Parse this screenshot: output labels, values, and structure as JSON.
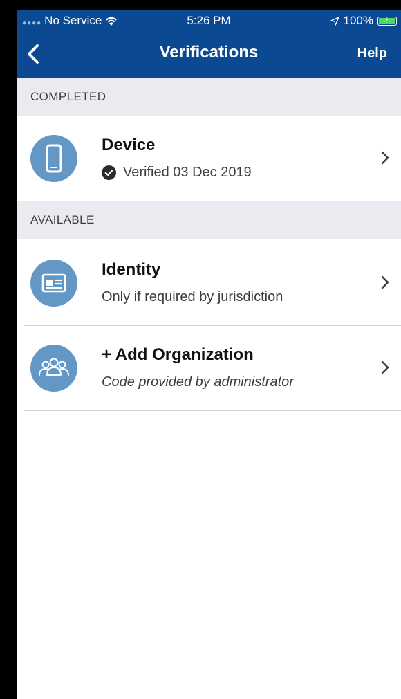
{
  "status_bar": {
    "carrier": "No Service",
    "time": "5:26 PM",
    "battery": "100%"
  },
  "nav": {
    "title": "Verifications",
    "help_label": "Help"
  },
  "sections": {
    "completed_label": "COMPLETED",
    "available_label": "AVAILABLE"
  },
  "rows": {
    "device": {
      "title": "Device",
      "subtitle": "Verified 03 Dec 2019",
      "icon": "phone-icon"
    },
    "identity": {
      "title": "Identity",
      "subtitle": "Only if required by jurisdiction",
      "icon": "id-card-icon"
    },
    "organization": {
      "title": "+ Add Organization",
      "subtitle": "Code provided by administrator",
      "icon": "group-icon"
    }
  },
  "colors": {
    "header_blue": "#0b4a93",
    "icon_circle": "#6398c6",
    "section_bg": "#eceaf1",
    "battery_green": "#4cd964"
  }
}
